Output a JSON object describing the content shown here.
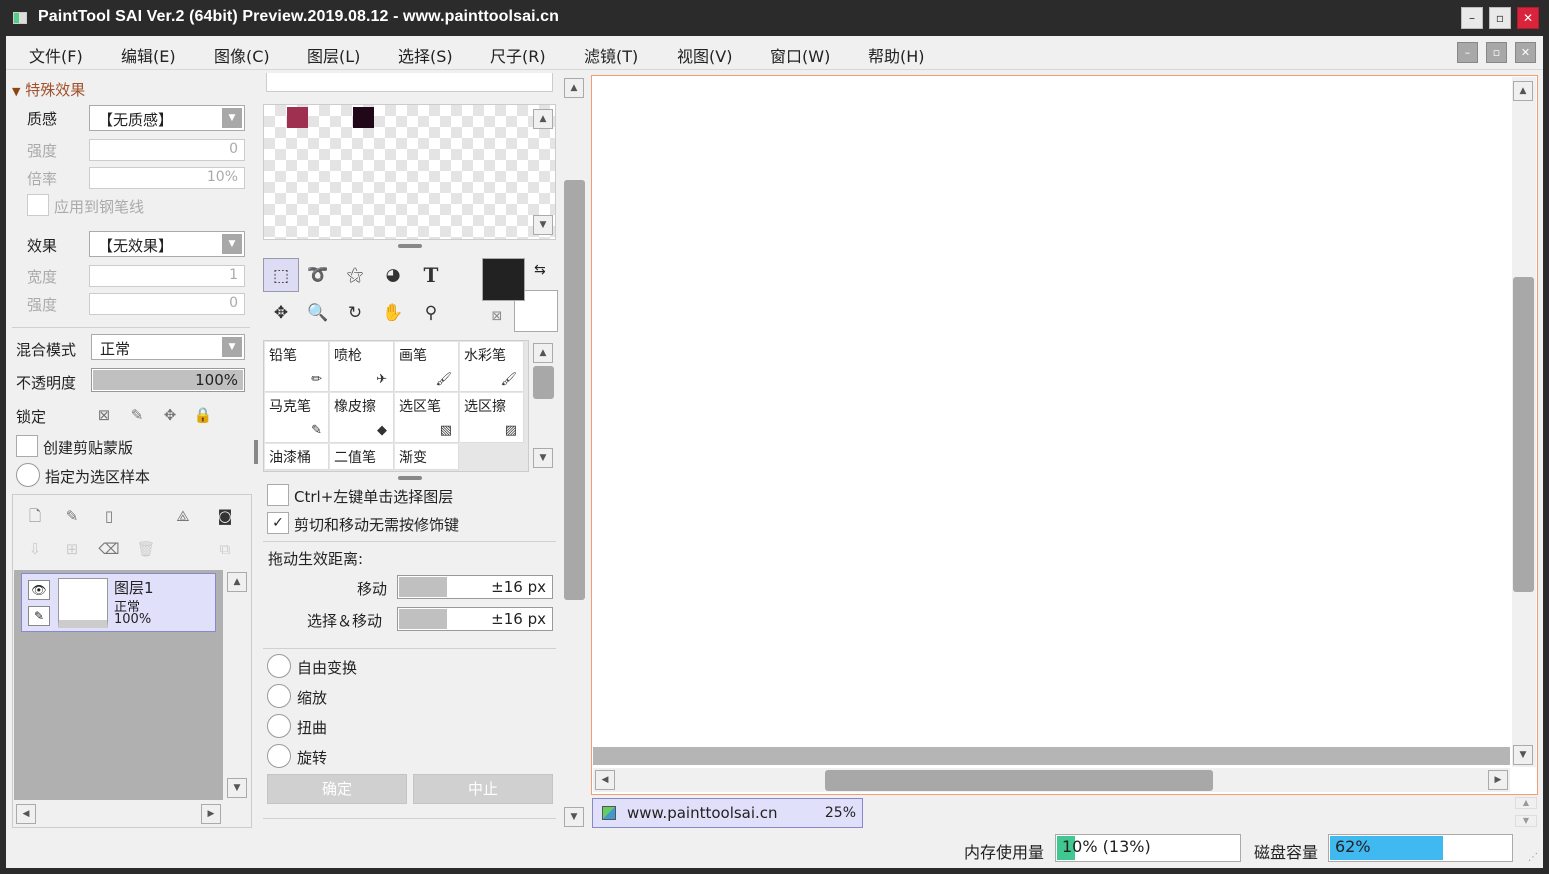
{
  "app": {
    "title": "PaintTool SAI Ver.2 (64bit) Preview.2019.08.12 - www.painttoolsai.cn"
  },
  "window_controls": {
    "minimize": "–",
    "maximize": "▫",
    "close": "✕"
  },
  "menu": [
    "文件(F)",
    "编辑(E)",
    "图像(C)",
    "图层(L)",
    "选择(S)",
    "尺子(R)",
    "滤镜(T)",
    "视图(V)",
    "窗口(W)",
    "帮助(H)"
  ],
  "effects": {
    "header": "特殊效果",
    "texture_label": "质感",
    "texture_value": "【无质感】",
    "strength_label": "强度",
    "strength_value": "0",
    "scale_label": "倍率",
    "scale_value": "10%",
    "apply_pen_label": "应用到钢笔线",
    "effect_label": "效果",
    "effect_value": "【无效果】",
    "width_label": "宽度",
    "width_value": "1",
    "strength2_label": "强度",
    "strength2_value": "0"
  },
  "layer_props": {
    "blend_label": "混合模式",
    "blend_value": "正常",
    "opacity_label": "不透明度",
    "opacity_value": "100%",
    "lock_label": "锁定",
    "clip_label": "创建剪贴蒙版",
    "sample_label": "指定为选区样本"
  },
  "layers": [
    {
      "name": "图层1",
      "mode": "正常",
      "opacity": "100%"
    }
  ],
  "swatches": [
    "#a03050",
    "#200818"
  ],
  "colors": {
    "primary": "#222222",
    "secondary": "#ffffff"
  },
  "tools": {
    "row1": [
      "select-rect",
      "lasso",
      "magic-wand",
      "shape",
      "T"
    ],
    "row2": [
      "move",
      "zoom",
      "rotate",
      "hand",
      "eyedropper"
    ]
  },
  "brushes": [
    "铅笔",
    "喷枪",
    "画笔",
    "水彩笔",
    "马克笔",
    "橡皮擦",
    "选区笔",
    "选区擦",
    "油漆桶",
    "二值笔",
    "渐变"
  ],
  "options": {
    "ctrl_click_label": "Ctrl+左键单击选择图层",
    "cut_move_label": "剪切和移动无需按修饰键",
    "cut_move_checked": "✓",
    "drag_distance_label": "拖动生效距离:",
    "move_label": "移动",
    "move_value": "±16 px",
    "select_move_label": "选择＆移动",
    "select_move_value": "±16 px",
    "transform_modes": [
      "自由变换",
      "缩放",
      "扭曲",
      "旋转"
    ],
    "ok_label": "确定",
    "cancel_label": "中止"
  },
  "canvas_tab": {
    "name": "www.painttoolsai.cn",
    "zoom": "25%"
  },
  "status": {
    "memory_label": "内存使用量",
    "memory_value": "10% (13%)",
    "memory_level": 0.1,
    "disk_label": "磁盘容量",
    "disk_value": "62%",
    "disk_level": 0.62
  }
}
